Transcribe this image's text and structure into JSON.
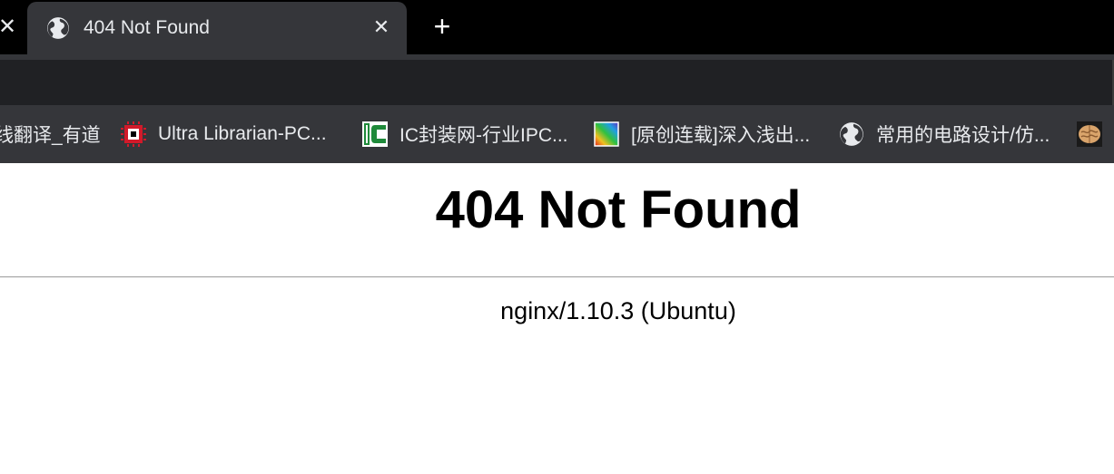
{
  "browser": {
    "tab": {
      "title": "404 Not Found",
      "icon": "globe-icon",
      "close_glyph": "✕"
    },
    "prev_tab_close_glyph": "✕",
    "new_tab_glyph": "+"
  },
  "bookmarks": [
    {
      "label": "线翻译_有道",
      "icon": "youdao-icon"
    },
    {
      "label": "Ultra Librarian-PC...",
      "icon": "chip-icon"
    },
    {
      "label": "IC封装网-行业IPC...",
      "icon": "ic-logo-icon"
    },
    {
      "label": "[原创连载]深入浅出...",
      "icon": "rainbow-icon"
    },
    {
      "label": "常用的电路设计/仿...",
      "icon": "globe-icon"
    },
    {
      "label": "",
      "icon": "brain-icon"
    }
  ],
  "page": {
    "heading": "404 Not Found",
    "server": "nginx/1.10.3 (Ubuntu)"
  },
  "colors": {
    "tabstrip": "#000000",
    "active_tab": "#35363a",
    "toolbar": "#202124",
    "bookmarks_bar": "#35363a",
    "text_light": "#e8eaed"
  }
}
